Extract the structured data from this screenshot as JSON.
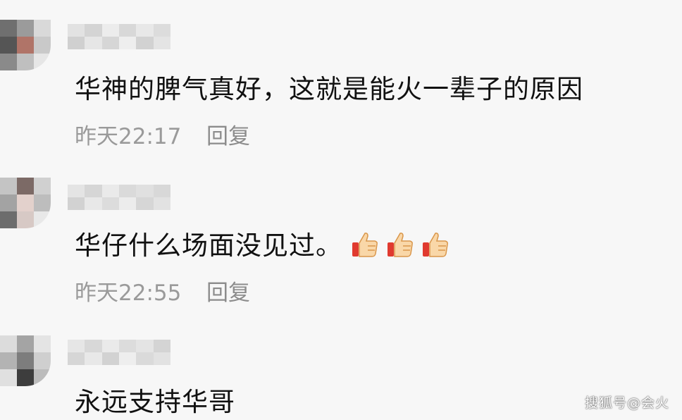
{
  "comments": [
    {
      "text": "华神的脾气真好，这就是能火一辈子的原因",
      "time": "昨天22:17",
      "reply_label": "回复"
    },
    {
      "text": "华仔什么场面没见过。",
      "time": "昨天22:55",
      "reply_label": "回复",
      "emoji": [
        "thumbs-up-icon",
        "thumbs-up-icon",
        "thumbs-up-icon"
      ]
    },
    {
      "text": "永远支持华哥"
    }
  ],
  "watermark": "搜狐号@会火"
}
